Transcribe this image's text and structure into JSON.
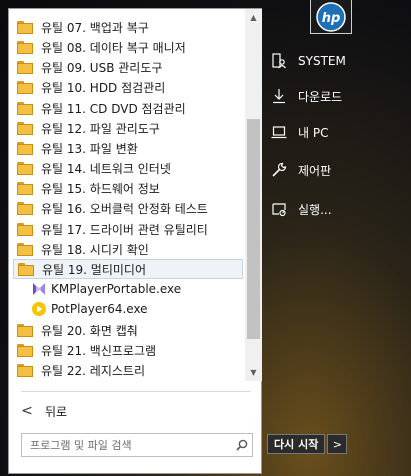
{
  "programs": [
    {
      "type": "folder",
      "label": "유틸 07. 백업과 복구"
    },
    {
      "type": "folder",
      "label": "유틸 08. 데이타 복구 매니저"
    },
    {
      "type": "folder",
      "label": "유틸 09. USB 관리도구"
    },
    {
      "type": "folder",
      "label": "유틸 10. HDD 점검관리"
    },
    {
      "type": "folder",
      "label": "유틸 11. CD DVD 점검관리"
    },
    {
      "type": "folder",
      "label": "유틸 12. 파일 관리도구"
    },
    {
      "type": "folder",
      "label": "유틸 13. 파일 변환"
    },
    {
      "type": "folder",
      "label": "유틸 14. 네트워크 인터넷"
    },
    {
      "type": "folder",
      "label": "유틸 15. 하드웨어 정보"
    },
    {
      "type": "folder",
      "label": "유틸 16. 오버클럭 안정화 테스트"
    },
    {
      "type": "folder",
      "label": "유틸 17. 드라이버 관련 유틸리티"
    },
    {
      "type": "folder",
      "label": "유틸 18. 시디키 확인"
    },
    {
      "type": "folder",
      "label": "유틸 19. 멀티미디어",
      "selected": true
    },
    {
      "type": "app",
      "label": "KMPlayerPortable.exe",
      "icon": "kmplayer-icon"
    },
    {
      "type": "app",
      "label": "PotPlayer64.exe",
      "icon": "potplayer-icon"
    },
    {
      "type": "folder",
      "label": "유틸 20. 화면 캡춰"
    },
    {
      "type": "folder",
      "label": "유틸 21. 백신프로그램"
    },
    {
      "type": "folder",
      "label": "유틸 22. 레지스트리"
    }
  ],
  "back_label": "뒤로",
  "search": {
    "placeholder": "프로그램 및 파일 검색"
  },
  "right_items": [
    {
      "label": "SYSTEM",
      "icon": "user-folder-icon"
    },
    {
      "label": "다운로드",
      "icon": "download-icon"
    },
    {
      "label": "내 PC",
      "icon": "computer-icon"
    },
    {
      "label": "제어판",
      "icon": "wrench-icon"
    },
    {
      "label": "실행...",
      "icon": "run-icon"
    }
  ],
  "shutdown_label": "다시 시작",
  "shutdown_arrow": ">",
  "scroll_up": "▲",
  "scroll_down": "▼",
  "back_chevron": "<"
}
